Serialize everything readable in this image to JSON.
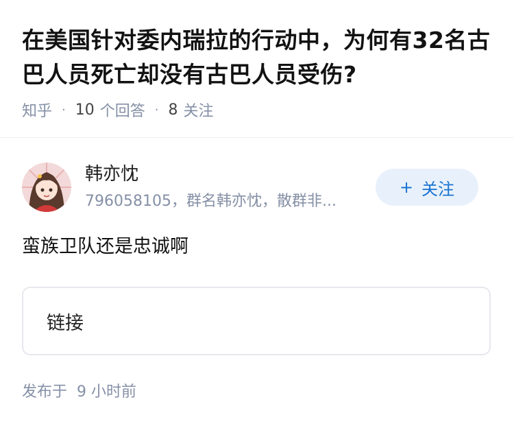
{
  "question": {
    "title": "在美国针对委内瑞拉的行动中，为何有32名古巴人员死亡却没有古巴人员受伤?",
    "site": "知乎",
    "answer_count": "10",
    "answer_label": "个回答",
    "follow_count": "8",
    "follow_label": "关注"
  },
  "author": {
    "name": "韩亦忱",
    "bio": "796058105，群名韩亦忱，散群非...",
    "follow_button_label": "关注",
    "follow_button_icon": "plus-icon"
  },
  "answer": {
    "text": "蛮族卫队还是忠诚啊",
    "link_card_label": "链接"
  },
  "footer": {
    "published_prefix": "发布于",
    "published_time": "9 小时前"
  },
  "colors": {
    "title": "#121212",
    "meta_gray": "#8590a6",
    "follow_bg": "#e8f1fb",
    "follow_text": "#1772d0",
    "card_border": "#e6e8ed"
  }
}
